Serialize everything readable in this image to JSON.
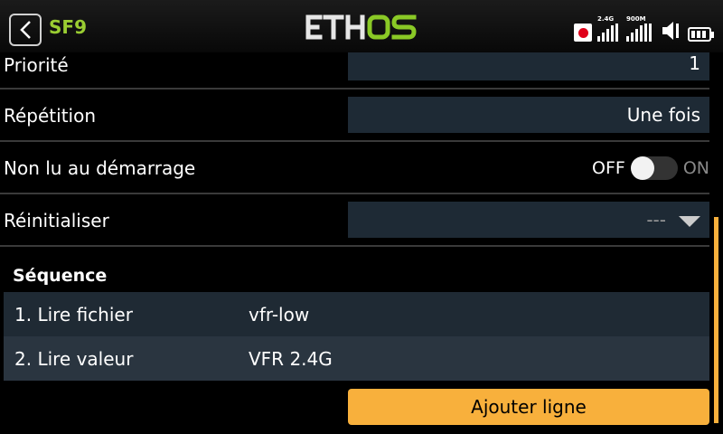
{
  "header": {
    "title": "SF9",
    "logo_text": "ETHOS",
    "rssi_1_label": "2.4G",
    "rssi_2_label": "900M"
  },
  "rows": {
    "priorite": {
      "label": "Priorité",
      "value": "1"
    },
    "repetition": {
      "label": "Répétition",
      "value": "Une fois"
    },
    "non_lu": {
      "label": "Non lu au démarrage",
      "off": "OFF",
      "on": "ON",
      "state": "off"
    },
    "reinitialiser": {
      "label": "Réinitialiser",
      "value": "---"
    }
  },
  "sequence": {
    "title": "Séquence",
    "items": [
      {
        "index": "1. Lire fichier",
        "value": "vfr-low"
      },
      {
        "index": "2. Lire valeur",
        "value": "VFR 2.4G"
      }
    ]
  },
  "add_button": "Ajouter ligne",
  "colors": {
    "accent": "#f8b03c",
    "title_green": "#9acd32",
    "field_bg": "#1e2a35"
  }
}
